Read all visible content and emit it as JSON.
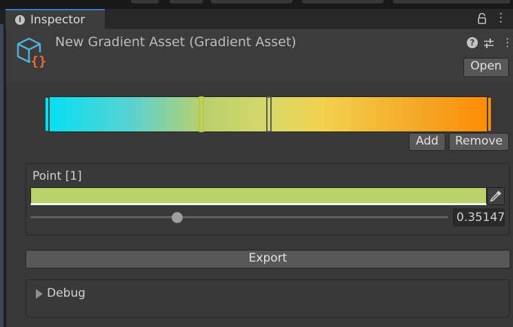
{
  "window": {
    "tab_title": "Inspector"
  },
  "asset": {
    "title": "New Gradient Asset (Gradient Asset)",
    "open_label": "Open"
  },
  "gradient": {
    "colors": {
      "start": "#00e0f4",
      "end": "#ff8a00",
      "selected": "#b9d26a",
      "accent": "#3a7bd5"
    },
    "add_label": "Add",
    "remove_label": "Remove"
  },
  "point": {
    "label": "Point [1]",
    "value": "0.35147",
    "position_fraction": 0.35147
  },
  "export_label": "Export",
  "debug": {
    "label": "Debug"
  },
  "icons": [
    "info-icon",
    "lock-icon",
    "kebab-icon",
    "gradient-asset-icon",
    "help-icon",
    "preset-icon",
    "more-icon",
    "eyedropper-icon",
    "foldout-arrow-icon"
  ]
}
